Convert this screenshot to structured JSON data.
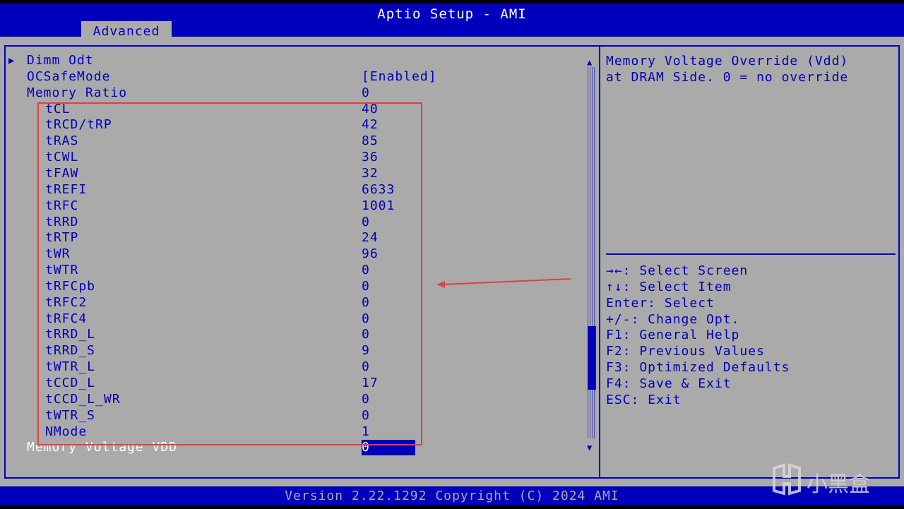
{
  "header": {
    "title": "Aptio Setup - AMI",
    "active_tab": "Advanced"
  },
  "settings": {
    "items": [
      {
        "label": "Dimm Odt",
        "value": "",
        "submenu": true,
        "indent": false
      },
      {
        "label": "OCSafeMode",
        "value": "[Enabled]",
        "submenu": false,
        "indent": false
      },
      {
        "label": "Memory Ratio",
        "value": "0",
        "submenu": false,
        "indent": false
      },
      {
        "label": "tCL",
        "value": "40",
        "submenu": false,
        "indent": true
      },
      {
        "label": "tRCD/tRP",
        "value": "42",
        "submenu": false,
        "indent": true
      },
      {
        "label": "tRAS",
        "value": "85",
        "submenu": false,
        "indent": true
      },
      {
        "label": "tCWL",
        "value": "36",
        "submenu": false,
        "indent": true
      },
      {
        "label": "tFAW",
        "value": "32",
        "submenu": false,
        "indent": true
      },
      {
        "label": "tREFI",
        "value": "6633",
        "submenu": false,
        "indent": true
      },
      {
        "label": "tRFC",
        "value": "1001",
        "submenu": false,
        "indent": true
      },
      {
        "label": "tRRD",
        "value": "0",
        "submenu": false,
        "indent": true
      },
      {
        "label": "tRTP",
        "value": "24",
        "submenu": false,
        "indent": true
      },
      {
        "label": "tWR",
        "value": "96",
        "submenu": false,
        "indent": true
      },
      {
        "label": "tWTR",
        "value": "0",
        "submenu": false,
        "indent": true
      },
      {
        "label": "tRFCpb",
        "value": "0",
        "submenu": false,
        "indent": true
      },
      {
        "label": "tRFC2",
        "value": "0",
        "submenu": false,
        "indent": true
      },
      {
        "label": "tRFC4",
        "value": "0",
        "submenu": false,
        "indent": true
      },
      {
        "label": "tRRD_L",
        "value": "0",
        "submenu": false,
        "indent": true
      },
      {
        "label": "tRRD_S",
        "value": "9",
        "submenu": false,
        "indent": true
      },
      {
        "label": "tWTR_L",
        "value": "0",
        "submenu": false,
        "indent": true
      },
      {
        "label": "tCCD_L",
        "value": "17",
        "submenu": false,
        "indent": true
      },
      {
        "label": "tCCD_L_WR",
        "value": "0",
        "submenu": false,
        "indent": true
      },
      {
        "label": "tWTR_S",
        "value": "0",
        "submenu": false,
        "indent": true
      },
      {
        "label": "NMode",
        "value": "1",
        "submenu": false,
        "indent": true
      }
    ],
    "selected": {
      "label": "Memory Voltage VDD",
      "value": "0"
    }
  },
  "help": {
    "description_line1": "Memory Voltage Override (Vdd)",
    "description_line2": "at DRAM Side. 0 = no override",
    "keys": [
      "→←: Select Screen",
      "↑↓: Select Item",
      "Enter: Select",
      "+/-: Change Opt.",
      "F1: General Help",
      "F2: Previous Values",
      "F3: Optimized Defaults",
      "F4: Save & Exit",
      "ESC: Exit"
    ]
  },
  "footer": {
    "text": "Version 2.22.1292 Copyright (C) 2024 AMI"
  },
  "watermark": {
    "text": "小黑盒"
  },
  "colors": {
    "bios_blue": "#0000bd",
    "bios_gray": "#aaaaaa",
    "annotation_red": "#e04040"
  },
  "icons": {
    "submenu": "triangle-right-icon",
    "scroll_up": "triangle-up-icon",
    "scroll_down": "triangle-down-icon"
  }
}
